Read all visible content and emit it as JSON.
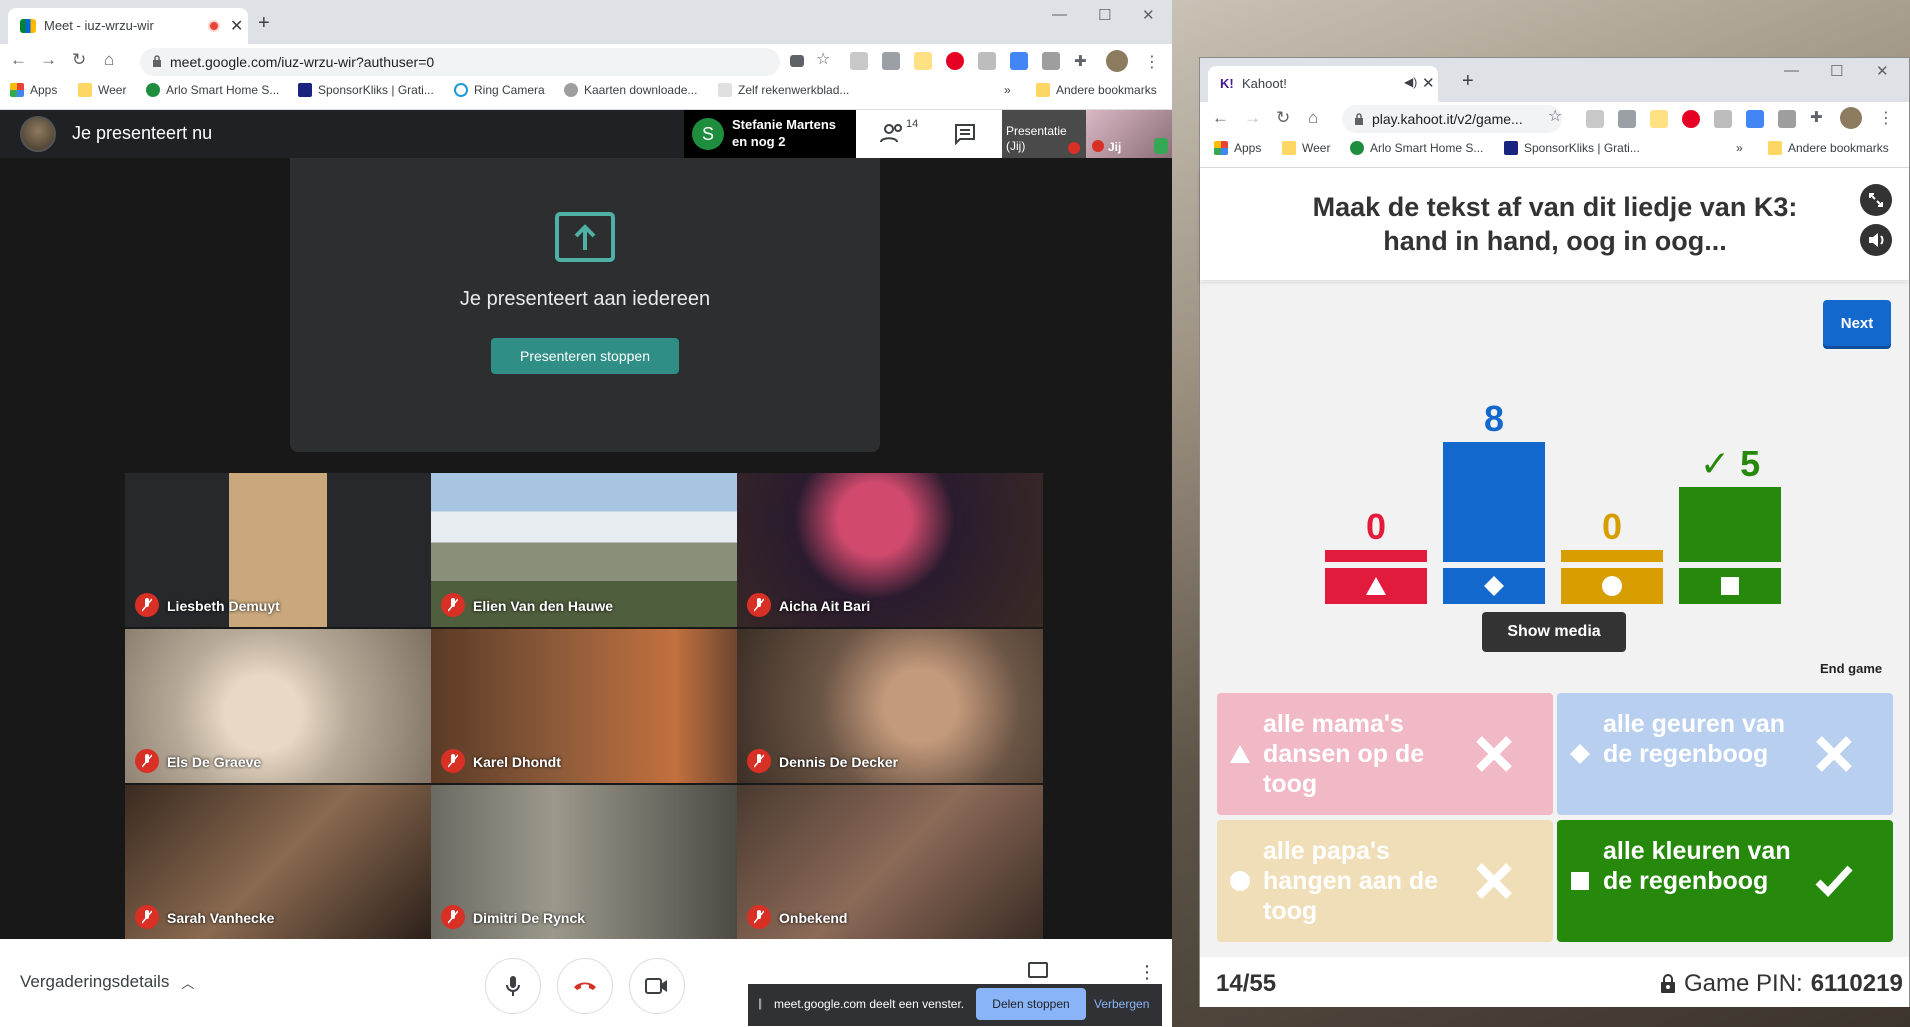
{
  "meet": {
    "tab_title": "Meet - iuz-wrzu-wir",
    "url": "meet.google.com/iuz-wrzu-wir?authuser=0",
    "bookmarks": [
      "Apps",
      "Weer",
      "Arlo Smart Home S...",
      "SponsorKliks | Grati...",
      "Ring Camera",
      "Kaarten downloade...",
      "Zelf rekenwerkblad...",
      "»",
      "Andere bookmarks"
    ],
    "presenting_now": "Je presenteert nu",
    "speaker": "Stefanie Martens en nog 2",
    "people_count": "14",
    "presentation_thumb": "Presentatie (Jij)",
    "self_thumb": "Jij",
    "present_message": "Je presenteert aan iedereen",
    "stop_presenting": "Presenteren stoppen",
    "participants": [
      "Liesbeth Demuyt",
      "Elien Van den Hauwe",
      "Aicha Ait Bari",
      "Els De Graeve",
      "Karel Dhondt",
      "Dennis De Decker",
      "Sarah Vanhecke",
      "Dimitri De Rynck",
      "Onbekend"
    ],
    "meeting_details": "Vergaderingsdetails",
    "share_text": "meet.google.com deelt een venster.",
    "share_stop": "Delen stoppen",
    "share_hide": "Verbergen"
  },
  "kahoot": {
    "tab_title": "Kahoot!",
    "url": "play.kahoot.it/v2/game...",
    "bookmarks": [
      "Apps",
      "Weer",
      "Arlo Smart Home S...",
      "SponsorKliks | Grati...",
      "»",
      "Andere bookmarks"
    ],
    "question": "Maak de tekst af van dit liedje van K3: hand in hand, oog in oog...",
    "next": "Next",
    "show_media": "Show media",
    "end_game": "End game",
    "results": [
      {
        "count": 0,
        "shape": "triangle",
        "color": "#e21b3c",
        "correct": false
      },
      {
        "count": 8,
        "shape": "diamond",
        "color": "#1368ce",
        "correct": false
      },
      {
        "count": 0,
        "shape": "circle",
        "color": "#d89e00",
        "correct": false
      },
      {
        "count": 5,
        "shape": "square",
        "color": "#26890c",
        "correct": true
      }
    ],
    "answers": [
      {
        "text": "alle mama's dansen op de toog",
        "shape": "triangle",
        "color": "#f1b8c5",
        "correct": false
      },
      {
        "text": "alle geuren van de regenboog",
        "shape": "diamond",
        "color": "#b8cfef",
        "correct": false
      },
      {
        "text": "alle papa's hangen aan de toog",
        "shape": "circle",
        "color": "#f0deb8",
        "correct": false
      },
      {
        "text": "alle kleuren van de regenboog",
        "shape": "square",
        "color": "#26890c",
        "correct": true
      }
    ],
    "question_count": "14/55",
    "game_pin_label": "Game PIN:",
    "game_pin": "6110219"
  }
}
